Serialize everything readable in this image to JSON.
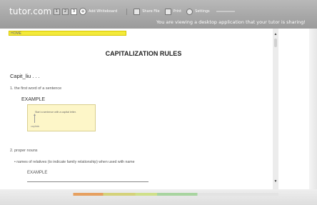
{
  "app": {
    "brand": "tutor.com",
    "notice": "You are viewing a desktop application that your tutor is sharing!"
  },
  "toolbar": {
    "pages": [
      "1",
      "2",
      "3"
    ],
    "add_whiteboard_label": "Add Whiteboard",
    "share_file_label": "Share File",
    "print_label": "Print",
    "settings_label": "Settings"
  },
  "document": {
    "header_text": "HOME",
    "title": "CAPITALIZATION RULES",
    "capit_heading": "Capit_liu . . .",
    "item1": "1.  the first word of a sentence",
    "example1_label": "EXAMPLE",
    "example_sentence": "Start a sentence with a capital letter.",
    "example_note": "capitals",
    "item2": "2.  proper nouns",
    "bullet1": "•  names of relatives (to indicate family relationship) when used with name",
    "example2_label": "EXAMPLE"
  },
  "colors": {
    "topbar": "#a9a9a9",
    "highlight": "#f3ea3a",
    "example_box": "#fdf6c8"
  }
}
